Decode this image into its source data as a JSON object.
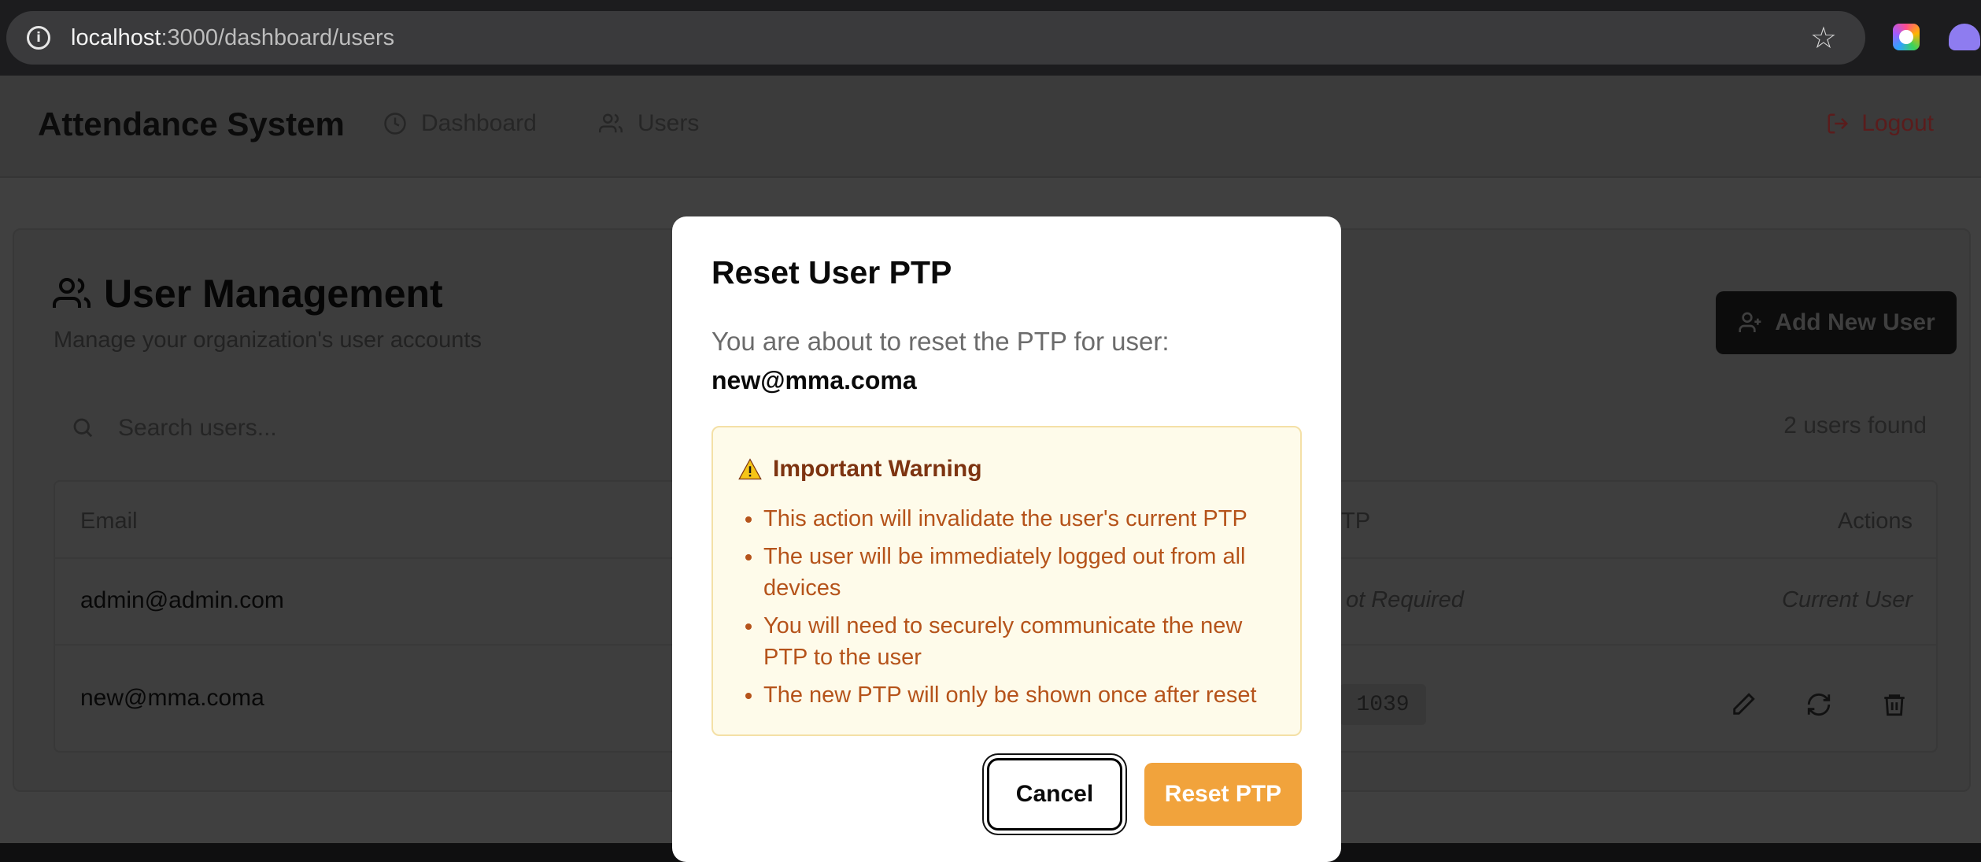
{
  "browser": {
    "url_host": "localhost",
    "url_path": ":3000/dashboard/users"
  },
  "nav": {
    "brand": "Attendance System",
    "items": [
      {
        "label": "Dashboard",
        "icon": "clock-icon"
      },
      {
        "label": "Users",
        "icon": "users-icon"
      }
    ],
    "logout_label": "Logout"
  },
  "page": {
    "title": "User Management",
    "subtitle": "Manage your organization's user accounts",
    "add_button_label": "Add New User",
    "search_placeholder": "Search users...",
    "users_count": "2 users found"
  },
  "table": {
    "columns": {
      "email": "Email",
      "ptp": "TP",
      "actions": "Actions"
    },
    "rows": [
      {
        "email": "admin@admin.com",
        "ptp": "ot Required",
        "actions": "Current User"
      },
      {
        "email": "new@mma.coma",
        "ptp": "1039",
        "actions": ""
      }
    ]
  },
  "modal": {
    "title": "Reset User PTP",
    "description": "You are about to reset the PTP for user:",
    "email": "new@mma.coma",
    "warning_title": "Important Warning",
    "warnings": [
      "This action will invalidate the user's current PTP",
      "The user will be immediately logged out from all devices",
      "You will need to securely communicate the new PTP to the user",
      "The new PTP will only be shown once after reset"
    ],
    "cancel_label": "Cancel",
    "confirm_label": "Reset PTP"
  },
  "colors": {
    "accent": "#f1a33c",
    "warning_text": "#b5531a",
    "warning_bg": "#fefbea",
    "logout": "#5a1c1c"
  }
}
